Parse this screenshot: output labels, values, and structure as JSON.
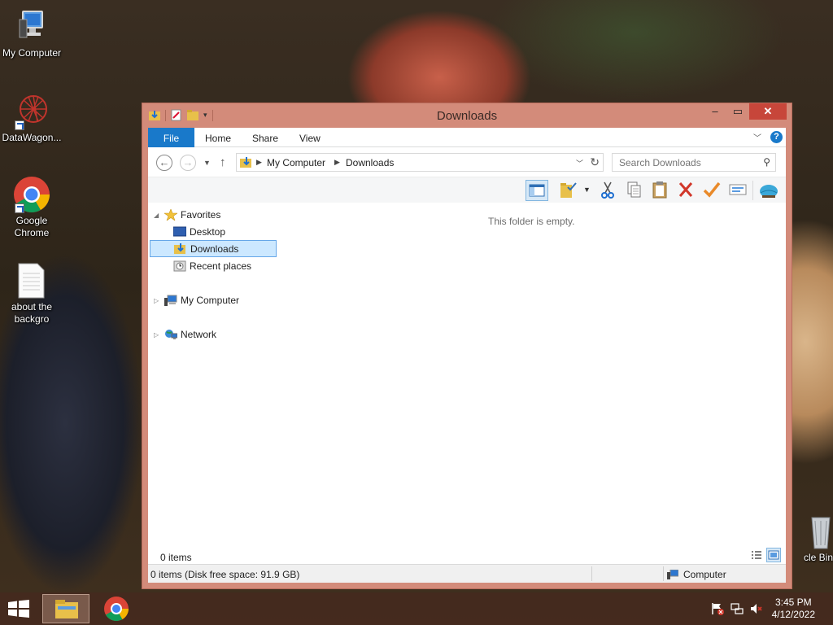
{
  "desktop": {
    "icons": [
      {
        "label": "My Computer",
        "icon": "computer-icon"
      },
      {
        "label": "DataWagon...",
        "icon": "datawagon-icon"
      },
      {
        "label": "Google Chrome",
        "icon": "chrome-icon"
      },
      {
        "label": "about the backgro",
        "icon": "text-file-icon"
      },
      {
        "label": "cle Bin",
        "icon": "recycle-bin-icon"
      }
    ]
  },
  "window": {
    "title": "Downloads",
    "ribbon_tabs": [
      "File",
      "Home",
      "Share",
      "View"
    ],
    "help": "?",
    "breadcrumb": [
      "My Computer",
      "Downloads"
    ],
    "search_placeholder": "Search Downloads",
    "nav_pane": {
      "favorites": "Favorites",
      "desktop": "Desktop",
      "downloads": "Downloads",
      "recent": "Recent places",
      "my_computer": "My Computer",
      "network": "Network"
    },
    "empty_message": "This folder is empty.",
    "items_count": "0 items",
    "status_left": "0 items (Disk free space: 91.9 GB)",
    "status_right": "Computer"
  },
  "taskbar": {
    "time": "3:45 PM",
    "date": "4/12/2022"
  },
  "colors": {
    "accent": "#1979ca",
    "window_frame": "#d38b7a",
    "close_button": "#c7463a",
    "selection": "#cce8ff"
  }
}
